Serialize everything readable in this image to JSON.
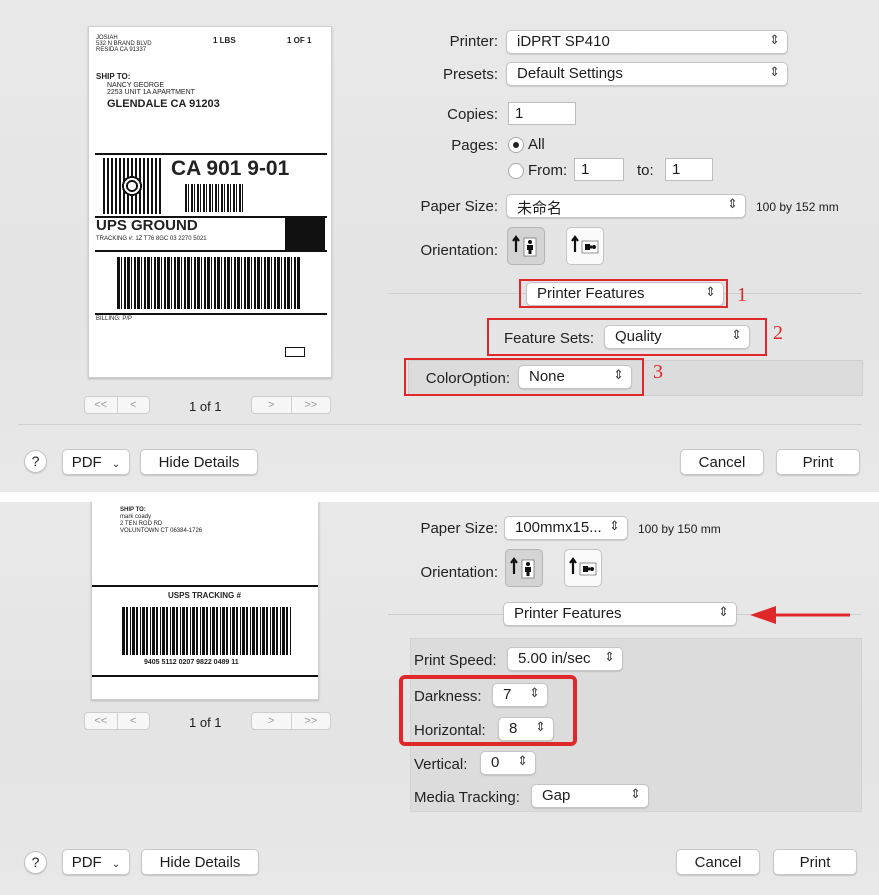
{
  "dialog1": {
    "printer": {
      "label": "Printer:",
      "value": "iDPRT SP410"
    },
    "presets": {
      "label": "Presets:",
      "value": "Default Settings"
    },
    "copies": {
      "label": "Copies:",
      "value": "1"
    },
    "pages": {
      "label": "Pages:",
      "all": "All",
      "from_label": "From:",
      "from_value": "1",
      "to_label": "to:",
      "to_value": "1"
    },
    "paper_size": {
      "label": "Paper Size:",
      "value": "未命名",
      "dimensions": "100 by 152 mm"
    },
    "orientation": {
      "label": "Orientation:"
    },
    "section_menu": {
      "value": "Printer Features"
    },
    "feature_sets": {
      "label": "Feature Sets:",
      "value": "Quality"
    },
    "color_option": {
      "label": "ColorOption:",
      "value": "None"
    },
    "annotations": [
      "1",
      "2",
      "3"
    ],
    "preview": {
      "page_counter": "1 of 1",
      "ship_from": [
        "JOSIAH",
        "532 N BRAND BLVD",
        "RESIDA CA 91337"
      ],
      "weight": "1 LBS",
      "count": "1 OF 1",
      "ship_to_label": "SHIP TO:",
      "ship_to_lines": [
        "NANCY GEORGE",
        "2253 UNIT 1A APARTMENT"
      ],
      "ship_to_city": "GLENDALE  CA  91203",
      "route": "CA 901 9-01",
      "service": "UPS GROUND",
      "tracking": "TRACKING #: 1Z T76 8GC 03 2270 5021",
      "billing": "BILLING: P/P"
    },
    "footer": {
      "help": "?",
      "pdf": "PDF",
      "hide_details": "Hide Details",
      "cancel": "Cancel",
      "print": "Print"
    }
  },
  "dialog2": {
    "paper_size": {
      "label": "Paper Size:",
      "value": "100mmx15...",
      "dimensions": "100 by 150 mm"
    },
    "orientation": {
      "label": "Orientation:"
    },
    "section_menu": {
      "value": "Printer Features"
    },
    "print_speed": {
      "label": "Print Speed:",
      "value": "5.00 in/sec"
    },
    "darkness": {
      "label": "Darkness:",
      "value": "7"
    },
    "horizontal": {
      "label": "Horizontal:",
      "value": "8"
    },
    "vertical": {
      "label": "Vertical:",
      "value": "0"
    },
    "media_tracking": {
      "label": "Media Tracking:",
      "value": "Gap"
    },
    "preview": {
      "page_counter": "1 of 1",
      "ship_to_label": "SHIP TO:",
      "ship_to_lines": [
        "mark coady",
        "2 TEN ROD RD",
        "VOLUNTOWN CT 06384-1726"
      ],
      "tracking_title": "USPS TRACKING #",
      "tracking_number": "9405 5112 0207 9822 0489 11"
    },
    "footer": {
      "help": "?",
      "pdf": "PDF",
      "hide_details": "Hide Details",
      "cancel": "Cancel",
      "print": "Print"
    }
  },
  "colors": {
    "highlight": "#e0282a",
    "panel": "#e6e6e6"
  }
}
